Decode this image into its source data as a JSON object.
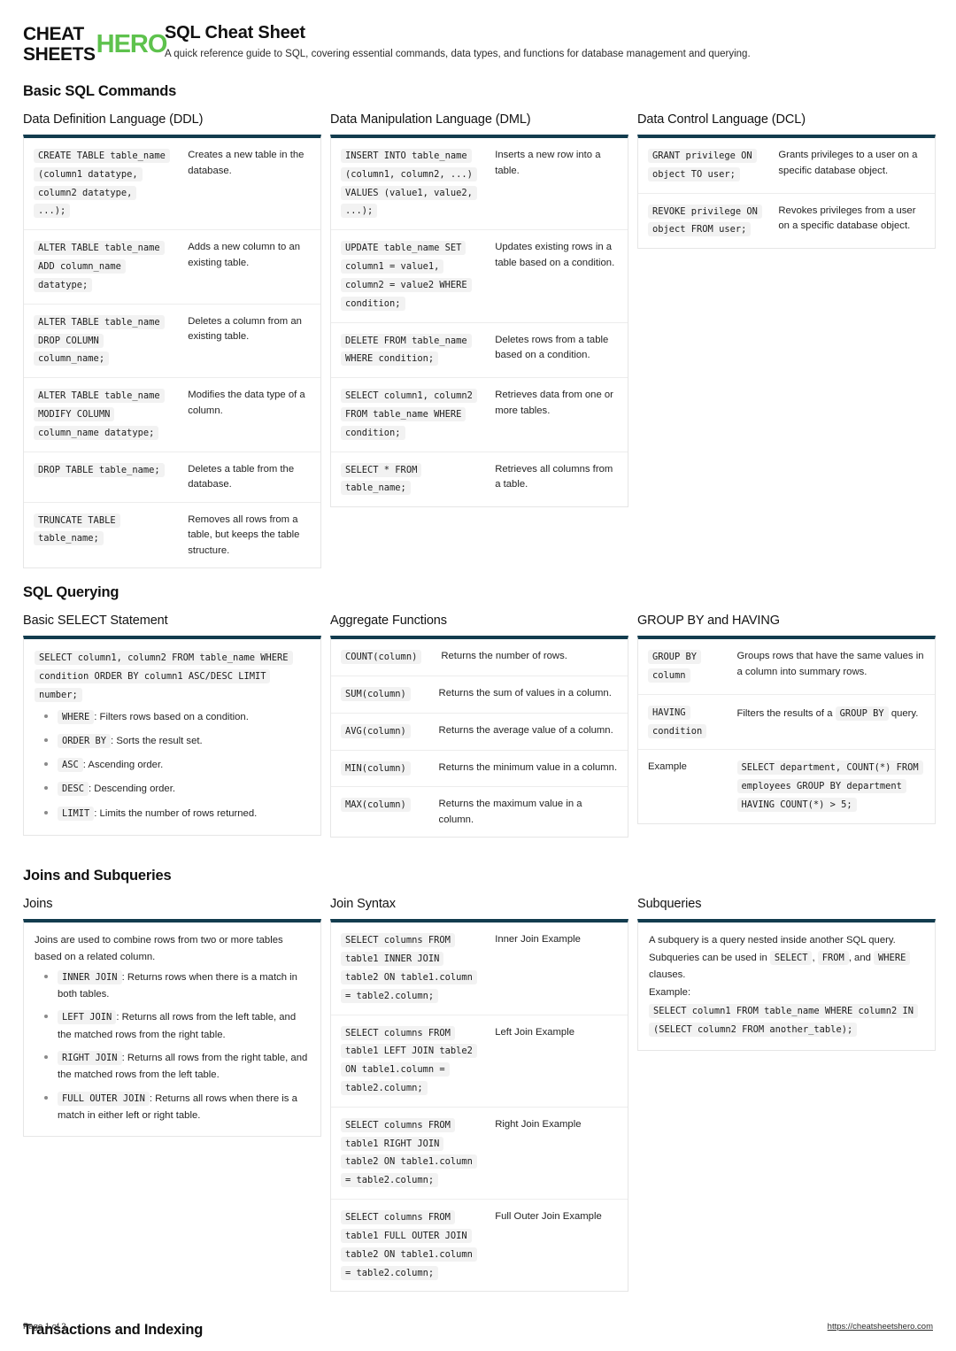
{
  "brand": {
    "line1_black": "CHEAT",
    "line2_black": "SHEETS",
    "accent_word": "HERO",
    "accent_color": "#5ec24d"
  },
  "header": {
    "title": "SQL Cheat Sheet",
    "subtitle": "A quick reference guide to SQL, covering essential commands, data types, and functions for database management and querying."
  },
  "sections": [
    {
      "title": "Basic SQL Commands"
    },
    {
      "title": "SQL Querying"
    },
    {
      "title": "Joins and Subqueries"
    },
    {
      "title": "Transactions and Indexing"
    }
  ],
  "ddl": {
    "title": "Data Definition Language (DDL)",
    "rows": [
      {
        "code": "CREATE TABLE table_name (column1 datatype, column2 datatype, ...);",
        "desc": "Creates a new table in the database."
      },
      {
        "code": "ALTER TABLE table_name ADD column_name datatype;",
        "desc": "Adds a new column to an existing table."
      },
      {
        "code": "ALTER TABLE table_name DROP COLUMN column_name;",
        "desc": "Deletes a column from an existing table."
      },
      {
        "code": "ALTER TABLE table_name MODIFY COLUMN column_name datatype;",
        "desc": "Modifies the data type of a column."
      },
      {
        "code": "DROP TABLE table_name;",
        "desc": "Deletes a table from the database."
      },
      {
        "code": "TRUNCATE TABLE table_name;",
        "desc": "Removes all rows from a table, but keeps the table structure."
      }
    ]
  },
  "dml": {
    "title": "Data Manipulation Language (DML)",
    "rows": [
      {
        "code": "INSERT INTO table_name (column1, column2, ...) VALUES (value1, value2, ...);",
        "desc": "Inserts a new row into a table."
      },
      {
        "code": "UPDATE table_name SET column1 = value1, column2 = value2 WHERE condition;",
        "desc": "Updates existing rows in a table based on a condition."
      },
      {
        "code": "DELETE FROM table_name WHERE condition;",
        "desc": "Deletes rows from a table based on a condition."
      },
      {
        "code": "SELECT column1, column2 FROM table_name WHERE condition;",
        "desc": "Retrieves data from one or more tables."
      },
      {
        "code": "SELECT * FROM table_name;",
        "desc": "Retrieves all columns from a table."
      }
    ]
  },
  "dcl": {
    "title": "Data Control Language (DCL)",
    "rows": [
      {
        "code": "GRANT privilege ON object TO user;",
        "desc": "Grants privileges to a user on a specific database object."
      },
      {
        "code": "REVOKE privilege ON object FROM user;",
        "desc": "Revokes privileges from a user on a specific database object."
      }
    ]
  },
  "basic_select": {
    "title": "Basic SELECT Statement",
    "statement": "SELECT column1, column2 FROM table_name WHERE condition ORDER BY column1 ASC/DESC LIMIT number;",
    "bullets": [
      {
        "code": "WHERE",
        "text": ": Filters rows based on a condition."
      },
      {
        "code": "ORDER BY",
        "text": ": Sorts the result set."
      },
      {
        "code": "ASC",
        "text": ": Ascending order."
      },
      {
        "code": "DESC",
        "text": ": Descending order."
      },
      {
        "code": "LIMIT",
        "text": ": Limits the number of rows returned."
      }
    ]
  },
  "aggregate": {
    "title": "Aggregate Functions",
    "rows": [
      {
        "code": "COUNT(column)",
        "desc": "Returns the number of rows."
      },
      {
        "code": "SUM(column)",
        "desc": "Returns the sum of values in a column."
      },
      {
        "code": "AVG(column)",
        "desc": "Returns the average value of a column."
      },
      {
        "code": "MIN(column)",
        "desc": "Returns the minimum value in a column."
      },
      {
        "code": "MAX(column)",
        "desc": "Returns the maximum value in a column."
      }
    ]
  },
  "group_by": {
    "title": "GROUP BY and HAVING",
    "rows": [
      {
        "code": "GROUP BY column",
        "desc": "Groups rows that have the same values in a column into summary rows."
      },
      {
        "code": "HAVING condition",
        "desc_pre": "Filters the results of a ",
        "desc_code": "GROUP BY",
        "desc_post": " query."
      }
    ],
    "example_label": "Example",
    "example_code": "SELECT department, COUNT(*) FROM employees GROUP BY department HAVING COUNT(*) > 5;"
  },
  "joins": {
    "title": "Joins",
    "intro": "Joins are used to combine rows from two or more tables based on a related column.",
    "bullets": [
      {
        "code": "INNER JOIN",
        "text": ": Returns rows when there is a match in both tables."
      },
      {
        "code": "LEFT JOIN",
        "text": ": Returns all rows from the left table, and the matched rows from the right table."
      },
      {
        "code": "RIGHT JOIN",
        "text": ": Returns all rows from the right table, and the matched rows from the left table."
      },
      {
        "code": "FULL OUTER JOIN",
        "text": ": Returns all rows when there is a match in either left or right table."
      }
    ]
  },
  "join_syntax": {
    "title": "Join Syntax",
    "rows": [
      {
        "code": "SELECT columns FROM table1 INNER JOIN table2 ON table1.column = table2.column;",
        "desc": "Inner Join Example"
      },
      {
        "code": "SELECT columns FROM table1 LEFT JOIN table2 ON table1.column = table2.column;",
        "desc": "Left Join Example"
      },
      {
        "code": "SELECT columns FROM table1 RIGHT JOIN table2 ON table1.column = table2.column;",
        "desc": "Right Join Example"
      },
      {
        "code": "SELECT columns FROM table1 FULL OUTER JOIN table2 ON table1.column = table2.column;",
        "desc": "Full Outer Join Example"
      }
    ]
  },
  "subqueries": {
    "title": "Subqueries",
    "intro_1": "A subquery is a query nested inside another SQL query. Subqueries can be used in ",
    "code_select": "SELECT",
    "intro_2": ", ",
    "code_from": "FROM",
    "intro_3": ", and ",
    "code_where": "WHERE",
    "intro_4": " clauses.",
    "example_label": "Example:",
    "example_code": "SELECT column1 FROM table_name WHERE column2 IN (SELECT column2 FROM another_table);"
  },
  "footer": {
    "page": "Page 1 of 2",
    "url": "https://cheatsheetshero.com"
  }
}
